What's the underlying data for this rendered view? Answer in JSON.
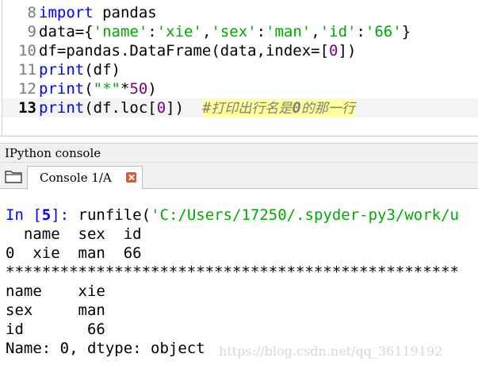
{
  "editor": {
    "line_numbers": [
      "8",
      "9",
      "10",
      "11",
      "12",
      "13"
    ],
    "current_line": "13",
    "lines": {
      "l8": {
        "kw": "import",
        "rest": " pandas"
      },
      "l9": {
        "a": "data={",
        "s1": "'name'",
        "c1": ":",
        "s2": "'xie'",
        "c2": ",",
        "s3": "'sex'",
        "c3": ":",
        "s4": "'man'",
        "c4": ",",
        "s5": "'id'",
        "c5": ":",
        "s6": "'66'",
        "end": "}"
      },
      "l10": {
        "a": "df=pandas.DataFrame(data,index=[",
        "n": "0",
        "b": "])"
      },
      "l11": {
        "kw": "print",
        "rest": "(df)"
      },
      "l12": {
        "kw": "print",
        "a": "(",
        "s": "\"*\"",
        "b": "*",
        "n": "50",
        "c": ")"
      },
      "l13": {
        "kw": "print",
        "a": "(df.loc[",
        "n": "0",
        "b": "])",
        "cmt_hash": "#",
        "cmt_text1": "打印出行名是",
        "cmt_digit": "0",
        "cmt_text2": "的那一行"
      }
    }
  },
  "pane": {
    "title": "IPython console"
  },
  "tabs": [
    {
      "label": "Console 1/A"
    }
  ],
  "icons": {
    "browse": "folder-icon",
    "close": "close-icon"
  },
  "console": {
    "prompt_in": "In [",
    "prompt_num": "5",
    "prompt_end": "]: ",
    "command": "runfile(",
    "command_arg": "'C:/Users/17250/.spyder-py3/work/u",
    "output": [
      "  name  sex  id",
      "0  xie  man  66",
      "**************************************************",
      "name    xie",
      "sex     man",
      "id       66",
      "Name: 0, dtype: object"
    ]
  },
  "watermark": "https://blog.csdn.net/qq_36119192",
  "colors": {
    "keyword": "#0000ff",
    "string": "#00aa00",
    "number": "#800080",
    "comment": "#808080",
    "comment_highlight": "#ffff99",
    "close_button": "#e8542c"
  }
}
